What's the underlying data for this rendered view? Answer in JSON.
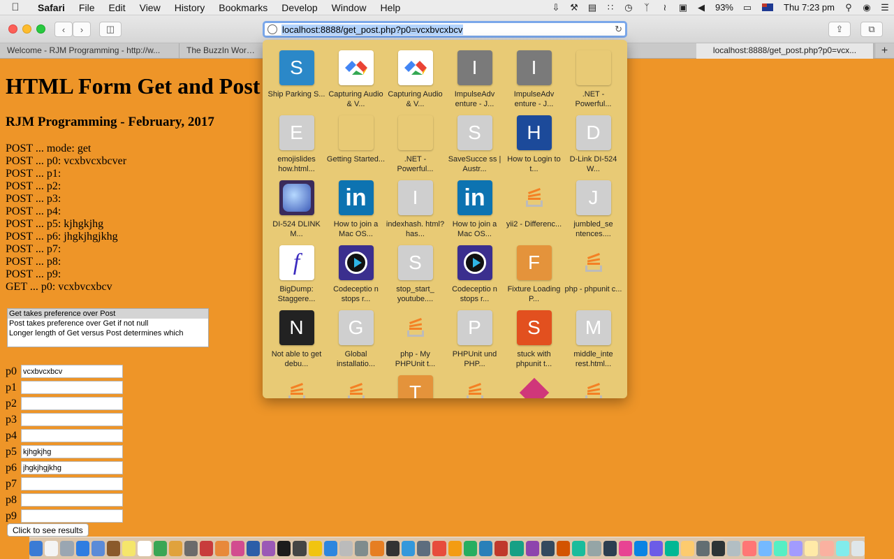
{
  "menubar": {
    "app": "Safari",
    "items": [
      "File",
      "Edit",
      "View",
      "History",
      "Bookmarks",
      "Develop",
      "Window",
      "Help"
    ],
    "battery": "93%",
    "clock": "Thu 7:23 pm"
  },
  "toolbar": {
    "url": "localhost:8888/get_post.php?p0=vcxbvcxbcv"
  },
  "tabs": [
    "Welcome - RJM Programming - http://w...",
    "The BuzzIn Word G",
    "localhost:8888/get_post.php?p0=vcx..."
  ],
  "page": {
    "title": "HTML Form Get and Post",
    "subtitle": "RJM Programming - February, 2017",
    "lines": [
      "POST ... mode: get",
      "POST ... p0: vcxbvcxbcver",
      "POST ... p1:",
      "POST ... p2:",
      "POST ... p3:",
      "POST ... p4:",
      "POST ... p5: kjhgkjhg",
      "POST ... p6: jhgkjhgjkhg",
      "POST ... p7:",
      "POST ... p8:",
      "POST ... p9:",
      "GET ... p0: vcxbvcxbcv"
    ],
    "options": [
      "Get takes preference over Post",
      "Post takes preference over Get if not null",
      "Longer length of Get versus Post determines which"
    ],
    "fields": [
      {
        "label": "p0",
        "value": "vcxbvcxbcv"
      },
      {
        "label": "p1",
        "value": ""
      },
      {
        "label": "p2",
        "value": ""
      },
      {
        "label": "p3",
        "value": ""
      },
      {
        "label": "p4",
        "value": ""
      },
      {
        "label": "p5",
        "value": "kjhgkjhg"
      },
      {
        "label": "p6",
        "value": "jhgkjhgjkhg"
      },
      {
        "label": "p7",
        "value": ""
      },
      {
        "label": "p8",
        "value": ""
      },
      {
        "label": "p9",
        "value": ""
      }
    ],
    "submit_label": "Click to see results"
  },
  "topsites": [
    {
      "letter": "S",
      "style": "blue",
      "caption": "Ship Parking S..."
    },
    {
      "letter": "",
      "style": "chrome",
      "caption": "Capturing Audio & V..."
    },
    {
      "letter": "",
      "style": "chrome",
      "caption": "Capturing Audio & V..."
    },
    {
      "letter": "I",
      "style": "dgrey",
      "caption": "ImpulseAdv enture - J..."
    },
    {
      "letter": "I",
      "style": "dgrey",
      "caption": "ImpulseAdv enture - J..."
    },
    {
      "letter": "",
      "style": "ms",
      "caption": ".NET - Powerful..."
    },
    {
      "letter": "E",
      "style": "grey",
      "caption": "emojislides how.html..."
    },
    {
      "letter": "",
      "style": "ms",
      "caption": "Getting Started..."
    },
    {
      "letter": "",
      "style": "ms",
      "caption": ".NET - Powerful..."
    },
    {
      "letter": "S",
      "style": "grey",
      "caption": "SaveSucce ss | Austr..."
    },
    {
      "letter": "H",
      "style": "navy",
      "caption": "How to Login to t..."
    },
    {
      "letter": "D",
      "style": "grey",
      "caption": "D-Link DI-524 W..."
    },
    {
      "letter": "",
      "style": "wave",
      "caption": "DI-524 DLINK M..."
    },
    {
      "letter": "in",
      "style": "li",
      "caption": "How to join a Mac OS..."
    },
    {
      "letter": "I",
      "style": "grey",
      "caption": "indexhash. html?has..."
    },
    {
      "letter": "in",
      "style": "li",
      "caption": "How to join a Mac OS..."
    },
    {
      "letter": "",
      "style": "so",
      "caption": "yii2 - Differenc..."
    },
    {
      "letter": "J",
      "style": "grey",
      "caption": "jumbled_se ntences...."
    },
    {
      "letter": "f",
      "style": "white",
      "caption": "BigDump: Staggere..."
    },
    {
      "letter": "",
      "style": "play",
      "caption": "Codeceptio n stops r..."
    },
    {
      "letter": "S",
      "style": "grey",
      "caption": "stop_start_ youtube...."
    },
    {
      "letter": "",
      "style": "play",
      "caption": "Codeceptio n stops r..."
    },
    {
      "letter": "F",
      "style": "orange",
      "caption": "Fixture Loading P..."
    },
    {
      "letter": "",
      "style": "so",
      "caption": "php - phpunit c..."
    },
    {
      "letter": "N",
      "style": "dark",
      "caption": "Not able to get debu..."
    },
    {
      "letter": "G",
      "style": "grey",
      "caption": "Global installatio..."
    },
    {
      "letter": "",
      "style": "so",
      "caption": "php - My PHPUnit t..."
    },
    {
      "letter": "P",
      "style": "grey",
      "caption": "PHPUnit und PHP..."
    },
    {
      "letter": "S",
      "style": "red",
      "caption": "stuck with phpunit t..."
    },
    {
      "letter": "M",
      "style": "grey",
      "caption": "middle_inte rest.html..."
    },
    {
      "letter": "",
      "style": "so",
      "caption": ""
    },
    {
      "letter": "",
      "style": "so",
      "caption": ""
    },
    {
      "letter": "T",
      "style": "orange",
      "caption": ""
    },
    {
      "letter": "",
      "style": "so",
      "caption": ""
    },
    {
      "letter": "",
      "style": "kite",
      "caption": ""
    },
    {
      "letter": "",
      "style": "so",
      "caption": ""
    }
  ],
  "dock_colors": [
    "#3a7bd5",
    "#f4f4f4",
    "#9aa6b2",
    "#2f7de1",
    "#5b8bd8",
    "#8a5a2b",
    "#f5e66b",
    "#ffffff",
    "#3aa655",
    "#e0a23c",
    "#6b6b6b",
    "#c83c3c",
    "#e8893a",
    "#d24c8f",
    "#2c5ea8",
    "#9b59b6",
    "#1c1c1c",
    "#444",
    "#f1c40f",
    "#2e86de",
    "#bbb",
    "#7f8c8d",
    "#e67e22",
    "#333",
    "#3498db",
    "#5d6d7e",
    "#e74c3c",
    "#f39c12",
    "#27ae60",
    "#2980b9",
    "#c0392b",
    "#16a085",
    "#8e44ad",
    "#34495e",
    "#d35400",
    "#1abc9c",
    "#95a5a6",
    "#2c3e50",
    "#e84393",
    "#0984e3",
    "#6c5ce7",
    "#00b894",
    "#fdcb6e",
    "#636e72",
    "#2d3436",
    "#b2bec3",
    "#ff7675",
    "#74b9ff",
    "#55efc4",
    "#a29bfe",
    "#ffeaa7",
    "#fab1a0",
    "#81ecec",
    "#dfe6e9"
  ]
}
